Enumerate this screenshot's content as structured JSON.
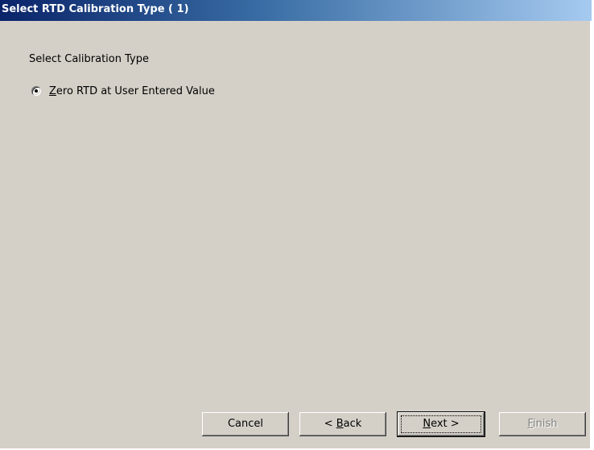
{
  "window": {
    "title": "Select RTD Calibration Type ( 1)"
  },
  "group": {
    "label": "Select Calibration Type"
  },
  "options": [
    {
      "mnemonic": "Z",
      "rest": "ero RTD at User Entered Value",
      "selected": true
    }
  ],
  "buttons": {
    "cancel": {
      "label": "Cancel"
    },
    "back": {
      "prefix": "< ",
      "mnemonic": "B",
      "rest": "ack"
    },
    "next": {
      "mnemonic": "N",
      "rest": "ext >"
    },
    "finish": {
      "mnemonic": "F",
      "rest": "inish",
      "enabled": false
    }
  },
  "colors": {
    "face": "#d4d0c8",
    "title_start": "#0a246a",
    "title_end": "#a6caf0",
    "disabled_text": "#808080"
  }
}
